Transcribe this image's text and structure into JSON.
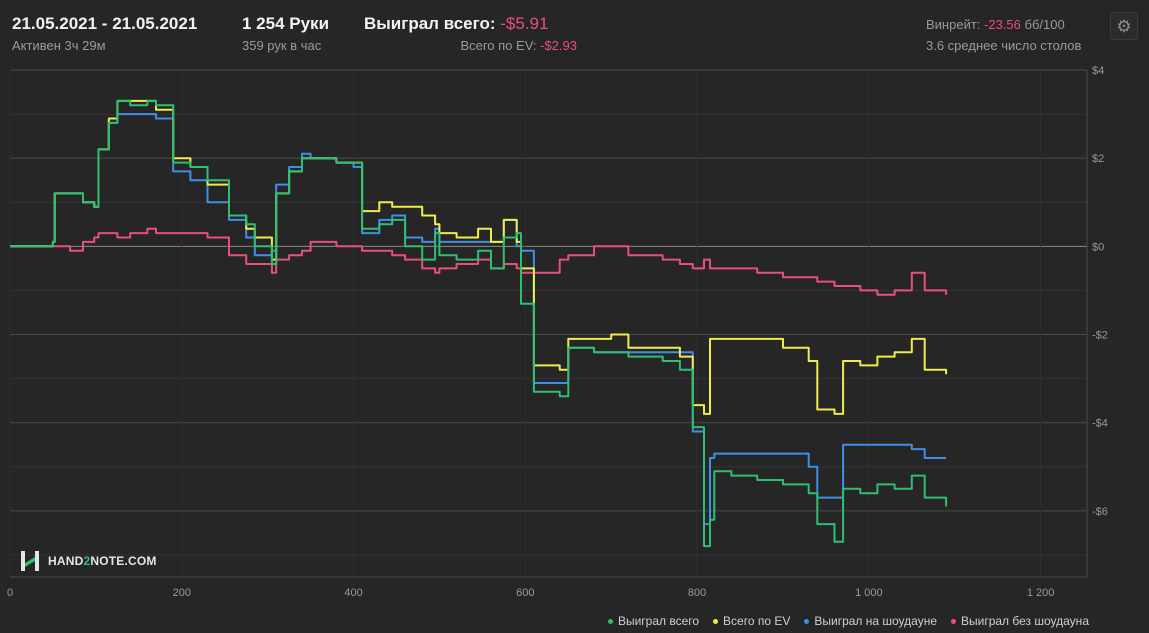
{
  "header": {
    "date_range": "21.05.2021 - 21.05.2021",
    "active_time": "Активен 3ч 29м",
    "hands": "1 254 Руки",
    "hands_per_hour": "359 рук в час",
    "won_total_label": "Выиграл всего:",
    "won_total_value": "-$5.91",
    "ev_total_label": "Всего по EV:",
    "ev_total_value": "-$2.93",
    "winrate_label": "Винрейт:",
    "winrate_value": "-23.56",
    "winrate_unit": "бб/100",
    "avg_tables": "3.6 среднее число столов"
  },
  "settings_icon": "gear-icon",
  "logo": {
    "prefix": "HAND",
    "accent": "2",
    "suffix": "NOTE.COM"
  },
  "colors": {
    "background": "#262626",
    "won_total": "#2fbf71",
    "ev": "#f0ec4b",
    "showdown": "#3f8fe8",
    "non_showdown": "#e8507a",
    "negative_text": "#e8507a"
  },
  "chart_data": {
    "type": "line",
    "xlabel": "",
    "ylabel": "",
    "xlim": [
      0,
      1254
    ],
    "ylim": [
      -7.5,
      4
    ],
    "x_ticks": [
      0,
      200,
      400,
      600,
      800,
      1000,
      1200
    ],
    "x_tick_labels": [
      "0",
      "200",
      "400",
      "600",
      "800",
      "1 000",
      "1 200"
    ],
    "y_ticks": [
      4,
      2,
      0,
      -2,
      -4,
      -6
    ],
    "y_tick_labels": [
      "$4",
      "$2",
      "$0",
      "-$2",
      "-$4",
      "-$6"
    ],
    "grid": true,
    "legend_position": "bottom-right",
    "series": [
      {
        "name": "Выиграл всего",
        "color": "#2fbf71",
        "points": [
          [
            0,
            0
          ],
          [
            30,
            0
          ],
          [
            50,
            0.1
          ],
          [
            52,
            1.2
          ],
          [
            70,
            1.2
          ],
          [
            85,
            1.0
          ],
          [
            98,
            0.9
          ],
          [
            103,
            2.2
          ],
          [
            115,
            2.8
          ],
          [
            125,
            3.3
          ],
          [
            140,
            3.2
          ],
          [
            160,
            3.3
          ],
          [
            170,
            3.2
          ],
          [
            190,
            1.9
          ],
          [
            210,
            1.8
          ],
          [
            230,
            1.5
          ],
          [
            255,
            0.7
          ],
          [
            275,
            0.5
          ],
          [
            285,
            0.0
          ],
          [
            305,
            -0.4
          ],
          [
            310,
            1.2
          ],
          [
            325,
            1.7
          ],
          [
            340,
            2.0
          ],
          [
            350,
            2.0
          ],
          [
            380,
            1.9
          ],
          [
            400,
            1.9
          ],
          [
            410,
            0.4
          ],
          [
            430,
            0.5
          ],
          [
            445,
            0.6
          ],
          [
            460,
            0.0
          ],
          [
            480,
            -0.3
          ],
          [
            495,
            0.3
          ],
          [
            500,
            -0.2
          ],
          [
            520,
            -0.3
          ],
          [
            545,
            -0.1
          ],
          [
            560,
            -0.5
          ],
          [
            575,
            0.2
          ],
          [
            590,
            0.3
          ],
          [
            595,
            -1.3
          ],
          [
            610,
            -3.3
          ],
          [
            640,
            -3.4
          ],
          [
            650,
            -2.3
          ],
          [
            680,
            -2.4
          ],
          [
            720,
            -2.5
          ],
          [
            760,
            -2.6
          ],
          [
            780,
            -2.8
          ],
          [
            795,
            -4.1
          ],
          [
            808,
            -6.8
          ],
          [
            815,
            -6.2
          ],
          [
            820,
            -5.1
          ],
          [
            840,
            -5.2
          ],
          [
            870,
            -5.3
          ],
          [
            900,
            -5.4
          ],
          [
            930,
            -5.6
          ],
          [
            940,
            -6.3
          ],
          [
            960,
            -6.7
          ],
          [
            970,
            -5.5
          ],
          [
            990,
            -5.6
          ],
          [
            1010,
            -5.4
          ],
          [
            1030,
            -5.5
          ],
          [
            1050,
            -5.2
          ],
          [
            1065,
            -5.7
          ],
          [
            1090,
            -5.9
          ]
        ]
      },
      {
        "name": "Всего по EV",
        "color": "#f0ec4b",
        "points": [
          [
            0,
            0
          ],
          [
            30,
            0
          ],
          [
            50,
            0.1
          ],
          [
            52,
            1.2
          ],
          [
            70,
            1.2
          ],
          [
            85,
            1.0
          ],
          [
            98,
            0.9
          ],
          [
            103,
            2.2
          ],
          [
            115,
            2.9
          ],
          [
            125,
            3.3
          ],
          [
            140,
            3.3
          ],
          [
            160,
            3.3
          ],
          [
            170,
            3.1
          ],
          [
            190,
            2.0
          ],
          [
            210,
            1.8
          ],
          [
            230,
            1.4
          ],
          [
            255,
            0.7
          ],
          [
            275,
            0.4
          ],
          [
            285,
            0.2
          ],
          [
            305,
            -0.3
          ],
          [
            310,
            1.2
          ],
          [
            325,
            1.7
          ],
          [
            340,
            2.0
          ],
          [
            350,
            2.0
          ],
          [
            380,
            1.9
          ],
          [
            400,
            1.9
          ],
          [
            410,
            0.8
          ],
          [
            430,
            1.0
          ],
          [
            445,
            0.9
          ],
          [
            460,
            0.9
          ],
          [
            480,
            0.7
          ],
          [
            495,
            0.5
          ],
          [
            500,
            0.3
          ],
          [
            520,
            0.2
          ],
          [
            545,
            0.4
          ],
          [
            560,
            0.1
          ],
          [
            575,
            0.6
          ],
          [
            590,
            0.1
          ],
          [
            595,
            -0.5
          ],
          [
            610,
            -2.7
          ],
          [
            640,
            -2.8
          ],
          [
            650,
            -2.1
          ],
          [
            680,
            -2.1
          ],
          [
            700,
            -2.0
          ],
          [
            720,
            -2.3
          ],
          [
            760,
            -2.3
          ],
          [
            780,
            -2.5
          ],
          [
            795,
            -3.6
          ],
          [
            808,
            -3.8
          ],
          [
            815,
            -2.1
          ],
          [
            840,
            -2.1
          ],
          [
            870,
            -2.1
          ],
          [
            900,
            -2.3
          ],
          [
            930,
            -2.6
          ],
          [
            940,
            -3.7
          ],
          [
            960,
            -3.8
          ],
          [
            970,
            -2.6
          ],
          [
            990,
            -2.7
          ],
          [
            1010,
            -2.5
          ],
          [
            1030,
            -2.4
          ],
          [
            1050,
            -2.1
          ],
          [
            1065,
            -2.8
          ],
          [
            1090,
            -2.9
          ]
        ]
      },
      {
        "name": "Выиграл на шоудауне",
        "color": "#3f8fe8",
        "points": [
          [
            0,
            0
          ],
          [
            30,
            0
          ],
          [
            50,
            0.1
          ],
          [
            52,
            1.2
          ],
          [
            70,
            1.2
          ],
          [
            85,
            1.0
          ],
          [
            98,
            0.9
          ],
          [
            103,
            2.2
          ],
          [
            115,
            2.8
          ],
          [
            125,
            3.0
          ],
          [
            140,
            3.0
          ],
          [
            160,
            3.0
          ],
          [
            170,
            2.9
          ],
          [
            190,
            1.7
          ],
          [
            210,
            1.5
          ],
          [
            230,
            1.0
          ],
          [
            255,
            0.6
          ],
          [
            275,
            0.2
          ],
          [
            285,
            -0.2
          ],
          [
            305,
            -0.1
          ],
          [
            310,
            1.4
          ],
          [
            325,
            1.8
          ],
          [
            340,
            2.1
          ],
          [
            350,
            2.0
          ],
          [
            380,
            1.9
          ],
          [
            400,
            1.8
          ],
          [
            410,
            0.3
          ],
          [
            430,
            0.6
          ],
          [
            445,
            0.7
          ],
          [
            460,
            0.2
          ],
          [
            480,
            0.1
          ],
          [
            495,
            0.4
          ],
          [
            500,
            0.1
          ],
          [
            520,
            0.1
          ],
          [
            545,
            0.1
          ],
          [
            560,
            0.1
          ],
          [
            575,
            0.6
          ],
          [
            590,
            0.0
          ],
          [
            595,
            -0.1
          ],
          [
            610,
            -3.1
          ],
          [
            640,
            -3.1
          ],
          [
            650,
            -2.3
          ],
          [
            680,
            -2.4
          ],
          [
            720,
            -2.4
          ],
          [
            760,
            -2.4
          ],
          [
            780,
            -2.4
          ],
          [
            795,
            -4.2
          ],
          [
            808,
            -6.3
          ],
          [
            815,
            -4.8
          ],
          [
            820,
            -4.7
          ],
          [
            840,
            -4.7
          ],
          [
            870,
            -4.7
          ],
          [
            900,
            -4.7
          ],
          [
            930,
            -5.0
          ],
          [
            940,
            -5.7
          ],
          [
            960,
            -5.7
          ],
          [
            970,
            -4.5
          ],
          [
            990,
            -4.5
          ],
          [
            1010,
            -4.5
          ],
          [
            1030,
            -4.5
          ],
          [
            1050,
            -4.6
          ],
          [
            1065,
            -4.8
          ],
          [
            1090,
            -4.8
          ]
        ]
      },
      {
        "name": "Выиграл без шоудауна",
        "color": "#e8507a",
        "points": [
          [
            0,
            0
          ],
          [
            30,
            0
          ],
          [
            50,
            0
          ],
          [
            70,
            -0.1
          ],
          [
            85,
            0.1
          ],
          [
            98,
            0.2
          ],
          [
            103,
            0.3
          ],
          [
            115,
            0.3
          ],
          [
            125,
            0.2
          ],
          [
            140,
            0.3
          ],
          [
            160,
            0.4
          ],
          [
            170,
            0.3
          ],
          [
            190,
            0.3
          ],
          [
            210,
            0.3
          ],
          [
            230,
            0.2
          ],
          [
            255,
            -0.2
          ],
          [
            275,
            -0.4
          ],
          [
            285,
            -0.4
          ],
          [
            305,
            -0.6
          ],
          [
            310,
            -0.3
          ],
          [
            325,
            -0.2
          ],
          [
            340,
            -0.1
          ],
          [
            350,
            0.1
          ],
          [
            380,
            0.0
          ],
          [
            400,
            0.0
          ],
          [
            410,
            -0.1
          ],
          [
            430,
            -0.1
          ],
          [
            445,
            -0.2
          ],
          [
            460,
            -0.3
          ],
          [
            480,
            -0.5
          ],
          [
            495,
            -0.6
          ],
          [
            500,
            -0.5
          ],
          [
            520,
            -0.4
          ],
          [
            545,
            -0.3
          ],
          [
            560,
            -0.5
          ],
          [
            575,
            -0.4
          ],
          [
            590,
            -0.5
          ],
          [
            595,
            -0.6
          ],
          [
            610,
            -0.6
          ],
          [
            640,
            -0.3
          ],
          [
            650,
            -0.2
          ],
          [
            680,
            0.0
          ],
          [
            700,
            0.0
          ],
          [
            720,
            -0.2
          ],
          [
            760,
            -0.3
          ],
          [
            780,
            -0.4
          ],
          [
            795,
            -0.5
          ],
          [
            808,
            -0.3
          ],
          [
            815,
            -0.5
          ],
          [
            840,
            -0.5
          ],
          [
            870,
            -0.6
          ],
          [
            900,
            -0.7
          ],
          [
            930,
            -0.7
          ],
          [
            940,
            -0.8
          ],
          [
            960,
            -0.9
          ],
          [
            970,
            -0.9
          ],
          [
            990,
            -1.0
          ],
          [
            1010,
            -1.1
          ],
          [
            1030,
            -1.0
          ],
          [
            1050,
            -0.6
          ],
          [
            1065,
            -1.0
          ],
          [
            1090,
            -1.1
          ]
        ]
      }
    ]
  }
}
